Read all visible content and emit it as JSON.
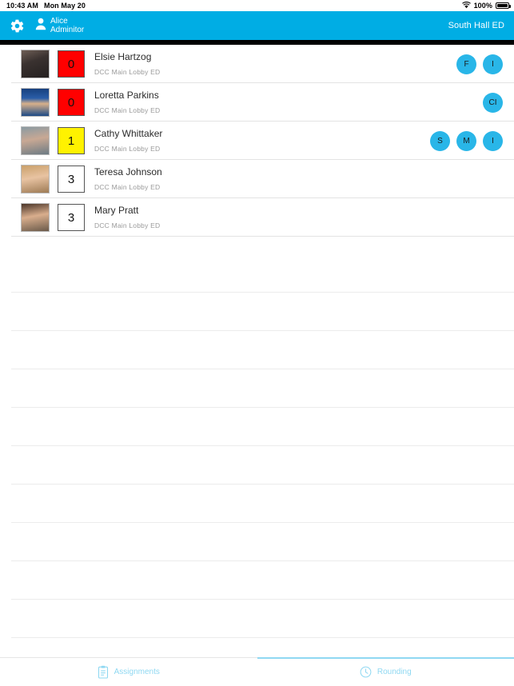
{
  "status_bar": {
    "time": "10:43 AM",
    "date": "Mon May 20",
    "wifi_icon": "wifi-icon",
    "battery_percent": "100%",
    "battery_icon": "battery-full-icon"
  },
  "app_bar": {
    "settings_icon": "gear-icon",
    "user_icon": "person-icon",
    "user_first_name": "Alice",
    "user_last_name": "Adminitor",
    "unit_label": "South Hall ED",
    "background_color": "#00ADE4"
  },
  "patients": [
    {
      "name": "Elsie Hartzog",
      "location": "DCC Main Lobby ED",
      "score": "0",
      "score_color": "#FF0000",
      "score_text_color": "#111111",
      "avatar_name": "patient-avatar-elsie-hartzog",
      "badges": [
        "F",
        "I"
      ]
    },
    {
      "name": "Loretta Parkins",
      "location": "DCC Main Lobby ED",
      "score": "0",
      "score_color": "#FF0000",
      "score_text_color": "#111111",
      "avatar_name": "patient-avatar-loretta-parkins",
      "badges": [
        "CI"
      ]
    },
    {
      "name": "Cathy Whittaker",
      "location": "DCC Main Lobby ED",
      "score": "1",
      "score_color": "#FFF200",
      "score_text_color": "#111111",
      "avatar_name": "patient-avatar-cathy-whittaker",
      "badges": [
        "S",
        "M",
        "I"
      ]
    },
    {
      "name": "Teresa Johnson",
      "location": "DCC Main Lobby ED",
      "score": "3",
      "score_color": "#FFFFFF",
      "score_text_color": "#111111",
      "avatar_name": "patient-avatar-teresa-johnson",
      "badges": []
    },
    {
      "name": "Mary Pratt",
      "location": "DCC Main Lobby ED",
      "score": "3",
      "score_color": "#FFFFFF",
      "score_text_color": "#111111",
      "avatar_name": "patient-avatar-mary-pratt",
      "badges": []
    }
  ],
  "empty_row_count": 11,
  "tab_bar": {
    "accent_color": "#8FD8F2",
    "tabs": [
      {
        "label": "Assignments",
        "icon": "clipboard-icon",
        "selected": false
      },
      {
        "label": "Rounding",
        "icon": "clock-icon",
        "selected": true
      }
    ]
  }
}
